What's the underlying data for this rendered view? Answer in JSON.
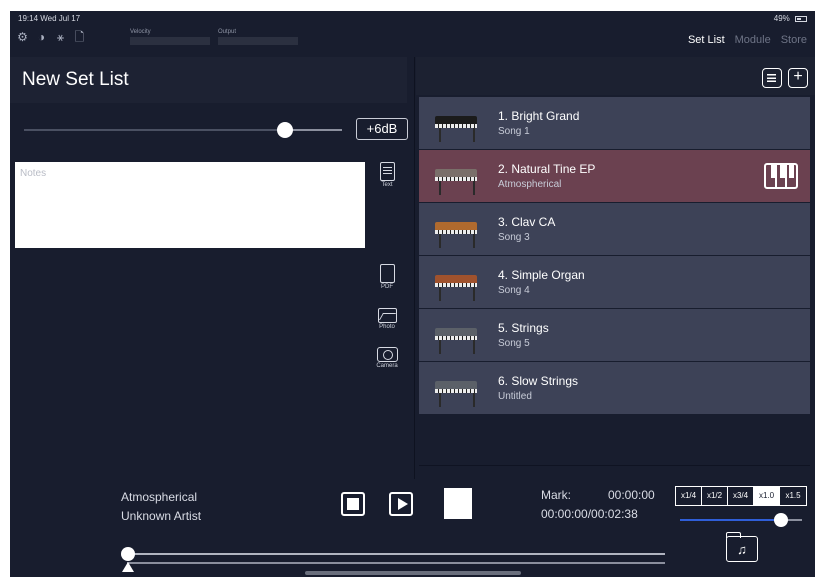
{
  "status_bar": {
    "time_date": "19:14  Wed Jul 17",
    "battery": "49%"
  },
  "toolbar": {
    "icons": [
      "gear-icon",
      "contrast-icon",
      "tuning-fork-icon",
      "document-icon"
    ],
    "velocity_label": "Velocity",
    "output_label": "Output",
    "tabs": [
      {
        "label": "Set List",
        "active": true
      },
      {
        "label": "Module",
        "active": false
      },
      {
        "label": "Store",
        "active": false
      }
    ]
  },
  "left_panel": {
    "title": "New Set List",
    "volume_level": 0.82,
    "gain_label": "+6dB",
    "notes_placeholder": "Notes",
    "tools": {
      "text": "Text",
      "pdf": "PDF",
      "photo": "Photo",
      "camera": "Camera"
    }
  },
  "songs": [
    {
      "name": "1. Bright Grand",
      "subtitle": "Song 1",
      "instrument": "grand-piano",
      "selected": false
    },
    {
      "name": "2. Natural Tine EP",
      "subtitle": "Atmospherical",
      "instrument": "electric-piano",
      "selected": true
    },
    {
      "name": "3. Clav CA",
      "subtitle": "Song 3",
      "instrument": "clavinet",
      "selected": false
    },
    {
      "name": "4. Simple Organ",
      "subtitle": "Song 4",
      "instrument": "organ",
      "selected": false
    },
    {
      "name": "5. Strings",
      "subtitle": "Song 5",
      "instrument": "keyboard",
      "selected": false
    },
    {
      "name": "6. Slow Strings",
      "subtitle": "Untitled",
      "instrument": "keyboard",
      "selected": false
    }
  ],
  "player": {
    "track_title": "Atmospherical",
    "artist": "Unknown Artist",
    "mark_label": "Mark:",
    "mark_time": "00:00:00",
    "elapsed": "00:00:00/00:02:38",
    "speeds": [
      "x1/4",
      "x1/2",
      "x3/4",
      "x1.0",
      "x1.5"
    ],
    "active_speed": "x1.0",
    "speed_level": 0.83,
    "position_level": 0.0
  },
  "colors": {
    "background": "#181d2e",
    "row": "#3d4257",
    "selected_row": "#6b4150",
    "accent_blue": "#2f5ed8"
  }
}
